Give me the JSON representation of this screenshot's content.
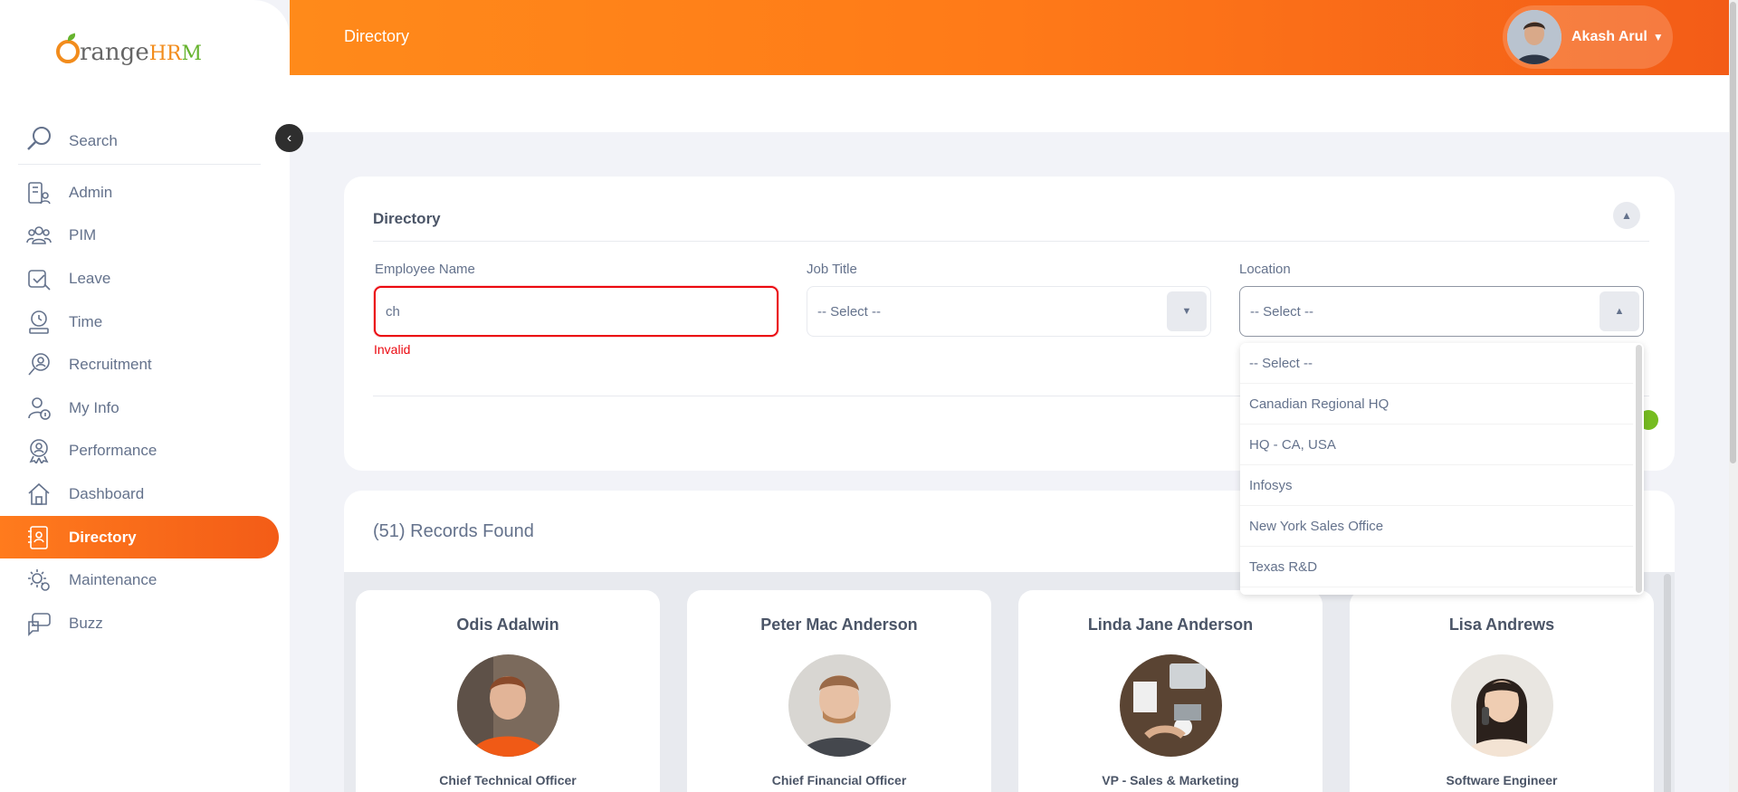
{
  "app": {
    "brand_main": "range",
    "brand_suffix_a": "HR",
    "brand_suffix_b": "M"
  },
  "topbar": {
    "title": "Directory",
    "user_name": "Akash Arul"
  },
  "sidebar": {
    "search_label": "Search",
    "items": [
      {
        "label": "Admin",
        "icon": "admin-icon"
      },
      {
        "label": "PIM",
        "icon": "pim-icon"
      },
      {
        "label": "Leave",
        "icon": "leave-icon"
      },
      {
        "label": "Time",
        "icon": "time-icon"
      },
      {
        "label": "Recruitment",
        "icon": "recruitment-icon"
      },
      {
        "label": "My Info",
        "icon": "my-info-icon"
      },
      {
        "label": "Performance",
        "icon": "performance-icon"
      },
      {
        "label": "Dashboard",
        "icon": "dashboard-icon"
      },
      {
        "label": "Directory",
        "icon": "directory-icon",
        "active": true
      },
      {
        "label": "Maintenance",
        "icon": "maintenance-icon"
      },
      {
        "label": "Buzz",
        "icon": "buzz-icon"
      }
    ]
  },
  "filter": {
    "title": "Directory",
    "employee_name_label": "Employee Name",
    "employee_name_value": "ch",
    "employee_name_error": "Invalid",
    "job_title_label": "Job Title",
    "job_title_value": "-- Select --",
    "location_label": "Location",
    "location_value": "-- Select --",
    "location_options": [
      "-- Select --",
      "Canadian Regional HQ",
      "HQ - CA, USA",
      "Infosys",
      "New York Sales Office",
      "Texas R&D"
    ]
  },
  "records": {
    "count_text": "(51) Records Found",
    "employees": [
      {
        "name": "Odis Adalwin",
        "job": "Chief Technical Officer"
      },
      {
        "name": "Peter Mac Anderson",
        "job": "Chief Financial Officer"
      },
      {
        "name": "Linda Jane Anderson",
        "job": "VP - Sales & Marketing"
      },
      {
        "name": "Lisa Andrews",
        "job": "Software Engineer"
      }
    ]
  },
  "colors": {
    "accent": "#ff7b1d",
    "error": "#eb0910",
    "green": "#76bc21"
  }
}
